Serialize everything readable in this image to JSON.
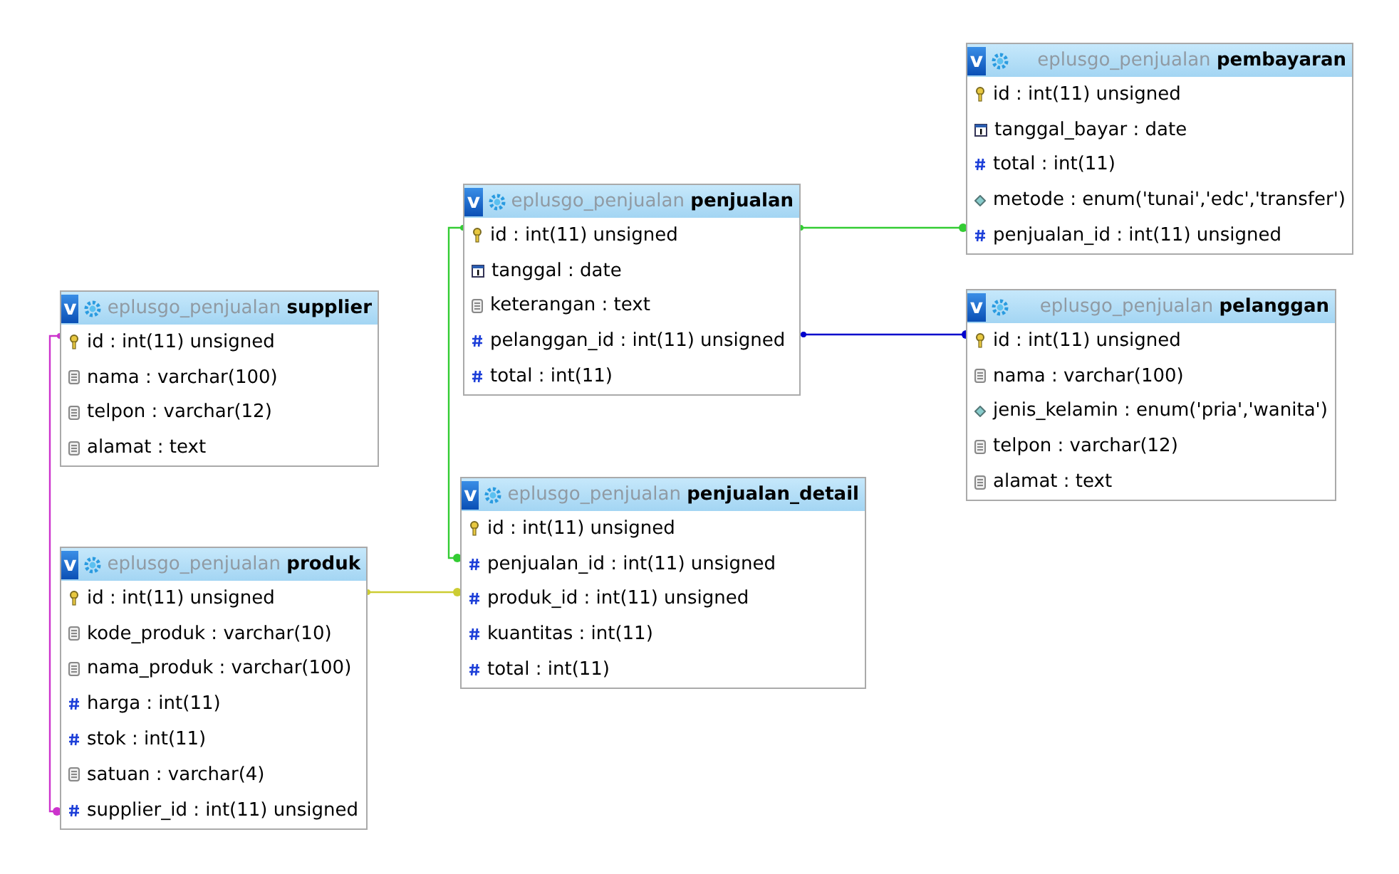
{
  "tables": [
    {
      "toggle": "v",
      "database": "eplusgo_penjualan",
      "name": "pembayaran",
      "columns": [
        {
          "kind": "key",
          "text": "id : int(11) unsigned"
        },
        {
          "kind": "date",
          "text": "tanggal_bayar : date"
        },
        {
          "kind": "number",
          "text": "total : int(11)"
        },
        {
          "kind": "enum",
          "text": "metode : enum('tunai','edc','transfer')"
        },
        {
          "kind": "number",
          "text": "penjualan_id : int(11) unsigned"
        }
      ]
    },
    {
      "toggle": "v",
      "database": "eplusgo_penjualan",
      "name": "penjualan",
      "columns": [
        {
          "kind": "key",
          "text": "id : int(11) unsigned"
        },
        {
          "kind": "date",
          "text": "tanggal : date"
        },
        {
          "kind": "text",
          "text": "keterangan : text"
        },
        {
          "kind": "number",
          "text": "pelanggan_id : int(11) unsigned"
        },
        {
          "kind": "number",
          "text": "total : int(11)"
        }
      ]
    },
    {
      "toggle": "v",
      "database": "eplusgo_penjualan",
      "name": "supplier",
      "columns": [
        {
          "kind": "key",
          "text": "id : int(11) unsigned"
        },
        {
          "kind": "text",
          "text": "nama : varchar(100)"
        },
        {
          "kind": "text",
          "text": "telpon : varchar(12)"
        },
        {
          "kind": "text",
          "text": "alamat : text"
        }
      ]
    },
    {
      "toggle": "v",
      "database": "eplusgo_penjualan",
      "name": "pelanggan",
      "columns": [
        {
          "kind": "key",
          "text": "id : int(11) unsigned"
        },
        {
          "kind": "text",
          "text": "nama : varchar(100)"
        },
        {
          "kind": "enum",
          "text": "jenis_kelamin : enum('pria','wanita')"
        },
        {
          "kind": "text",
          "text": "telpon : varchar(12)"
        },
        {
          "kind": "text",
          "text": "alamat : text"
        }
      ]
    },
    {
      "toggle": "v",
      "database": "eplusgo_penjualan",
      "name": "penjualan_detail",
      "columns": [
        {
          "kind": "key",
          "text": "id : int(11) unsigned"
        },
        {
          "kind": "number",
          "text": "penjualan_id : int(11) unsigned"
        },
        {
          "kind": "number",
          "text": "produk_id : int(11) unsigned"
        },
        {
          "kind": "number",
          "text": "kuantitas : int(11)"
        },
        {
          "kind": "number",
          "text": "total : int(11)"
        }
      ]
    },
    {
      "toggle": "v",
      "database": "eplusgo_penjualan",
      "name": "produk",
      "columns": [
        {
          "kind": "key",
          "text": "id : int(11) unsigned"
        },
        {
          "kind": "text",
          "text": "kode_produk : varchar(10)"
        },
        {
          "kind": "text",
          "text": "nama_produk : varchar(100)"
        },
        {
          "kind": "number",
          "text": "harga : int(11)"
        },
        {
          "kind": "number",
          "text": "stok : int(11)"
        },
        {
          "kind": "text",
          "text": "satuan : varchar(4)"
        },
        {
          "kind": "number",
          "text": "supplier_id : int(11) unsigned"
        }
      ]
    }
  ],
  "relations": [
    {
      "color": "#33cc33"
    },
    {
      "color": "#33cc33"
    },
    {
      "color": "#0000cc"
    },
    {
      "color": "#cccc33"
    },
    {
      "color": "#cc33cc"
    }
  ]
}
